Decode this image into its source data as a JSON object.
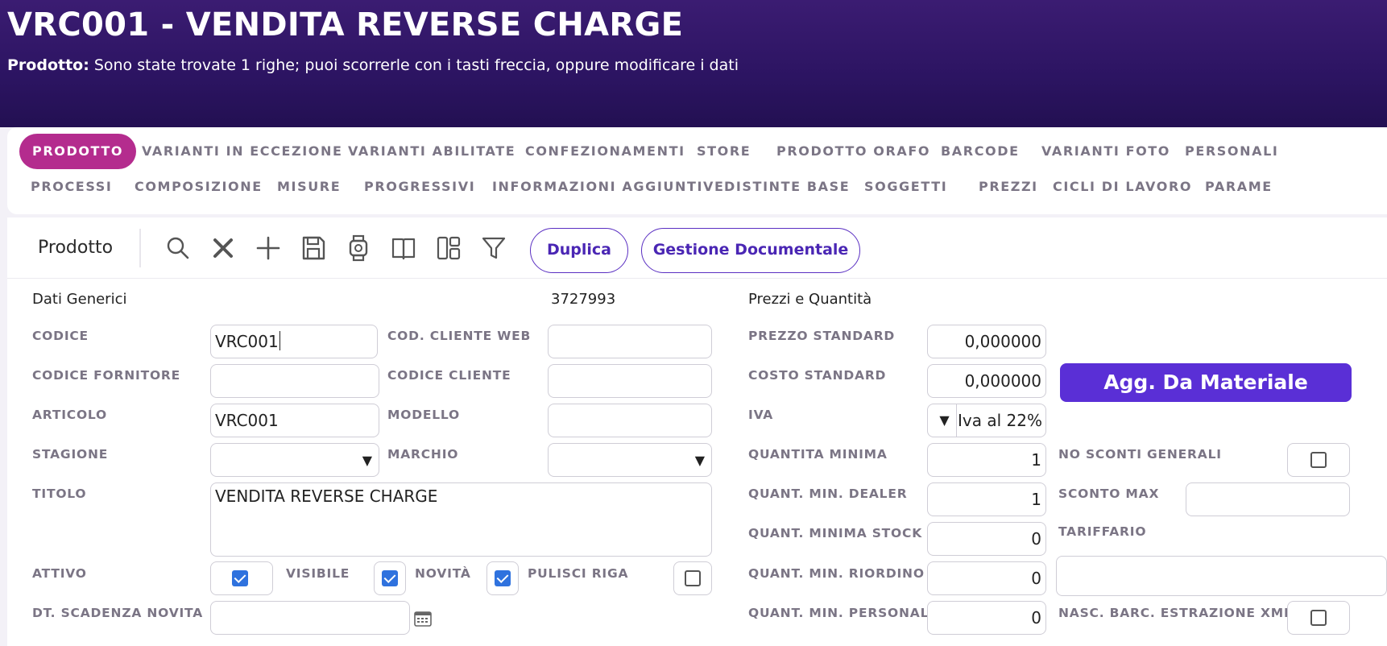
{
  "header": {
    "title": "VRC001 - VENDITA REVERSE CHARGE",
    "subtitle_label": "Prodotto:",
    "subtitle_text": "Sono state trovate 1 righe; puoi scorrerle con i tasti freccia, oppure modificare i dati"
  },
  "tabs": {
    "row1": [
      "PRODOTTO",
      "VARIANTI IN ECCEZIONE",
      "VARIANTI ABILITATE",
      "CONFEZIONAMENTI",
      "STORE",
      "PRODOTTO ORAFO",
      "BARCODE",
      "VARIANTI FOTO",
      "PERSONALI"
    ],
    "row2": [
      "PROCESSI",
      "COMPOSIZIONE",
      "MISURE",
      "PROGRESSIVI",
      "INFORMAZIONI AGGIUNTIVE",
      "DISTINTE BASE",
      "SOGGETTI",
      "PREZZI",
      "CICLI DI LAVORO",
      "PARAME"
    ],
    "active": "PRODOTTO"
  },
  "toolbar": {
    "title": "Prodotto",
    "icons": [
      "search-icon",
      "close-icon",
      "plus-icon",
      "save-icon",
      "watch-icon",
      "book-icon",
      "layout-icon",
      "filter-icon"
    ],
    "duplica_label": "Duplica",
    "gestione_label": "Gestione Documentale"
  },
  "generic": {
    "section_title": "Dati Generici",
    "record_id": "3727993",
    "codice_label": "CODICE",
    "codice_value": "VRC001",
    "cod_cliente_web_label": "COD. CLIENTE WEB",
    "cod_cliente_web_value": "",
    "codice_fornitore_label": "CODICE FORNITORE",
    "codice_fornitore_value": "",
    "codice_cliente_label": "CODICE CLIENTE",
    "codice_cliente_value": "",
    "articolo_label": "ARTICOLO",
    "articolo_value": "VRC001",
    "modello_label": "MODELLO",
    "modello_value": "",
    "stagione_label": "STAGIONE",
    "stagione_value": "",
    "marchio_label": "MARCHIO",
    "marchio_value": "",
    "titolo_label": "TITOLO",
    "titolo_value": "VENDITA REVERSE CHARGE",
    "attivo_label": "ATTIVO",
    "attivo_checked": true,
    "visibile_label": "VISIBILE",
    "visibile_checked": true,
    "novita_label": "NOVITÀ",
    "novita_checked": true,
    "pulisci_riga_label": "PULISCI RIGA",
    "pulisci_riga_checked": false,
    "dt_scadenza_label": "DT. SCADENZA NOVITA",
    "dt_scadenza_value": ""
  },
  "prices": {
    "section_title": "Prezzi e Quantità",
    "prezzo_standard_label": "PREZZO STANDARD",
    "prezzo_standard_value": "0,000000",
    "costo_standard_label": "COSTO STANDARD",
    "costo_standard_value": "0,000000",
    "agg_button_label": "Agg. Da Materiale",
    "iva_label": "IVA",
    "iva_value": "Iva al 22%",
    "quantita_minima_label": "QUANTITA MINIMA",
    "quantita_minima_value": "1",
    "no_sconti_label": "NO SCONTI GENERALI",
    "no_sconti_checked": false,
    "quant_min_dealer_label": "QUANT. MIN. DEALER",
    "quant_min_dealer_value": "1",
    "sconto_max_label": "SCONTO MAX",
    "sconto_max_value": "",
    "quant_minima_stock_label": "QUANT. MINIMA STOCK",
    "quant_minima_stock_value": "0",
    "tariffario_label": "TARIFFARIO",
    "tariffario_value": "",
    "quant_min_riordino_label": "QUANT. MIN. RIORDINO",
    "quant_min_riordino_value": "0",
    "quant_min_personal_label": "QUANT. MIN. PERSONAL.",
    "quant_min_personal_value": "0",
    "nasc_barc_label": "NASC. BARC. ESTRAZIONE XML",
    "nasc_barc_checked": false
  },
  "colors": {
    "header_bg": "#2c1462",
    "active_tab": "#b42c8e",
    "primary_button": "#5a2fd6",
    "checkbox_on": "#2f72de"
  }
}
